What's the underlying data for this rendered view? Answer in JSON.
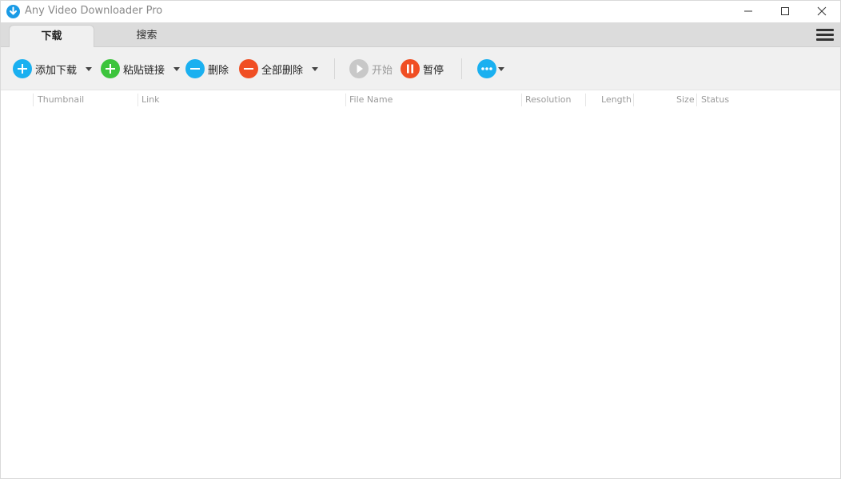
{
  "window": {
    "title": "Any Video Downloader Pro",
    "accent_color": "#1a9be6"
  },
  "tabs": [
    {
      "label": "下载",
      "active": true
    },
    {
      "label": "搜索",
      "active": false
    }
  ],
  "toolbar": {
    "add_download": "添加下载",
    "paste_link": "粘贴链接",
    "delete": "删除",
    "delete_all": "全部删除",
    "start": "开始",
    "pause": "暂停",
    "colors": {
      "add": "#1ab0f0",
      "paste": "#3cc43c",
      "delete": "#1ab0f0",
      "delete_all": "#f04e23",
      "start": "#c8c8c8",
      "pause": "#f04e23",
      "more": "#1ab0f0"
    }
  },
  "columns": {
    "thumbnail": "Thumbnail",
    "link": "Link",
    "file_name": "File Name",
    "resolution": "Resolution",
    "length": "Length",
    "size": "Size",
    "status": "Status"
  }
}
